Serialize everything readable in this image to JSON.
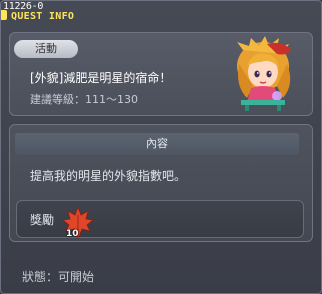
{
  "window": {
    "quest_id": "11226-0",
    "title": "QUEST INFO"
  },
  "info": {
    "badge": "活動",
    "quest_name": "[外貌]減肥是明星的宿命！",
    "level_label": "建議等級：111～130"
  },
  "content": {
    "header": "內容",
    "description": "提高我的明星的外貌指數吧。"
  },
  "reward": {
    "label": "獎勵",
    "item_icon": "maple-leaf-icon",
    "quantity": "10"
  },
  "status": {
    "text": "狀態：可開始"
  },
  "colors": {
    "title": "#ffe45a",
    "background": "#3a3d47"
  }
}
